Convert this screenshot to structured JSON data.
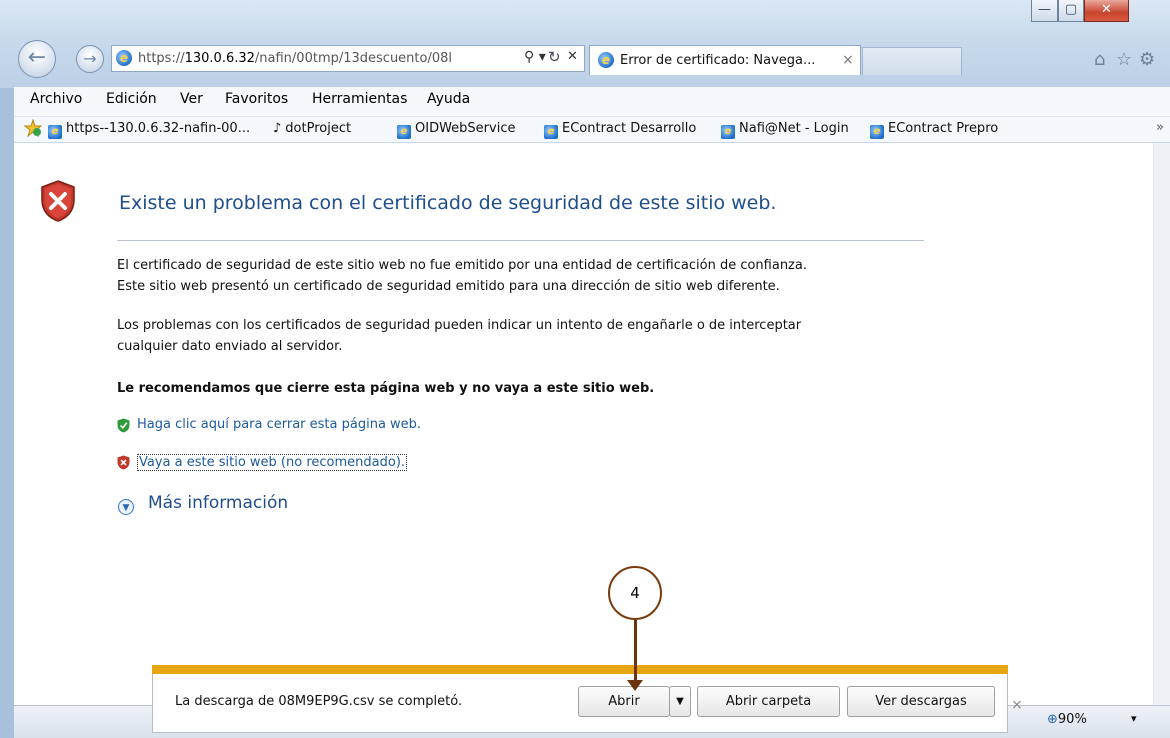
{
  "browser": {
    "address_url_prefix": "https://",
    "address_url_host": "130.0.6.32",
    "address_url_path": "/nafin/00tmp/13descuento/08l",
    "address_search_glyph": "⚲ ▾",
    "address_refresh_glyph": "↻",
    "address_stop_glyph": "✕",
    "tab_title": "Error de certificado: Navega...",
    "tab_close": "×",
    "window_buttons": {
      "minimize": "—",
      "maximize": "▢",
      "close": "✕"
    },
    "right_icons": {
      "home": "⌂",
      "favorites": "☆",
      "tools": "⚙"
    }
  },
  "menu": [
    "Archivo",
    "Edición",
    "Ver",
    "Favoritos",
    "Herramientas",
    "Ayuda"
  ],
  "favorites_bar": [
    "https--130.0.6.32-nafin-00...",
    "dotProject",
    "OIDWebService",
    "EContract Desarrollo",
    "Nafi@Net - Login",
    "EContract Prepro"
  ],
  "favorites_more": "»",
  "page": {
    "heading": "Existe un problema con el certificado de seguridad de este sitio web.",
    "para1_line1": "El certificado de seguridad de este sitio web no fue emitido por una entidad de certificación de confianza.",
    "para1_line2": "Este sitio web presentó un certificado de seguridad emitido para una dirección de sitio web diferente.",
    "para2_line1": "Los problemas con los certificados de seguridad pueden indicar un intento de engañarle o de interceptar",
    "para2_line2": "cualquier dato enviado al servidor.",
    "recommendation": "Le recomendamos que cierre esta página web y no vaya a este sitio web.",
    "link_close": "Haga clic aquí para cerrar esta página web.",
    "link_continue": "Vaya a este sitio web (no recomendado).",
    "more_info": "Más información"
  },
  "download_bar": {
    "message": "La descarga de 08M9EP9G.csv se completó.",
    "open": "Abrir",
    "open_folder": "Abrir carpeta",
    "view_downloads": "Ver descargas",
    "close": "×"
  },
  "status": {
    "zoom": "90%",
    "zoom_menu": "▾"
  },
  "annotation": {
    "step": "4"
  },
  "colors": {
    "download_accent": "#e6a512",
    "heading": "#1f4e8c",
    "link": "#1d5a9e",
    "shield_red": "#c0392b",
    "shield_green": "#2e9a3c"
  }
}
